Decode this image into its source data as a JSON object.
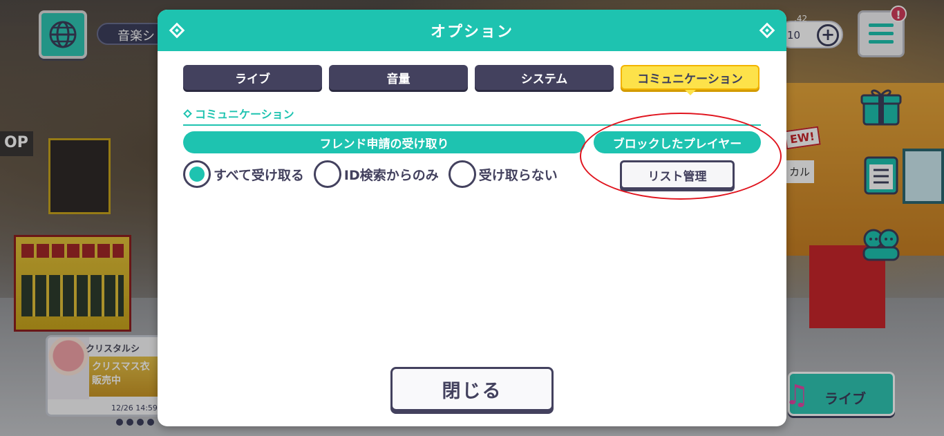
{
  "background": {
    "music_label": "音楽シ",
    "hud_currency_small": ".42",
    "hud_currency_value": "10",
    "plus_label": "+",
    "alert_badge": "!",
    "sign_text": "OP",
    "new_badge": "EW!",
    "side_label": "カル",
    "banner": {
      "tag": "クリスタルシ",
      "headline": "クリスマス衣 販売中",
      "date": "12/26 14:59"
    },
    "live_button_label": "ライブ"
  },
  "dialog": {
    "title": "オプション",
    "tabs": [
      {
        "label": "ライブ",
        "active": false
      },
      {
        "label": "音量",
        "active": false
      },
      {
        "label": "システム",
        "active": false
      },
      {
        "label": "コミュニケーション",
        "active": true
      }
    ],
    "section_title": "コミュニケーション",
    "friend_request": {
      "label": "フレンド申請の受け取り",
      "options": [
        {
          "label": "すべて受け取る",
          "selected": true
        },
        {
          "label": "ID検索からのみ",
          "selected": false
        },
        {
          "label": "受け取らない",
          "selected": false
        }
      ]
    },
    "blocked_players": {
      "label": "ブロックしたプレイヤー",
      "button_label": "リスト管理"
    },
    "close_label": "閉じる"
  },
  "colors": {
    "accent": "#1ec3b0",
    "tab_dark": "#43415e",
    "tab_active": "#fde24a",
    "highlight": "#e0141e"
  },
  "icons": [
    "globe-icon",
    "menu-icon",
    "gift-icon",
    "list-icon",
    "friends-icon",
    "music-note-icon"
  ]
}
